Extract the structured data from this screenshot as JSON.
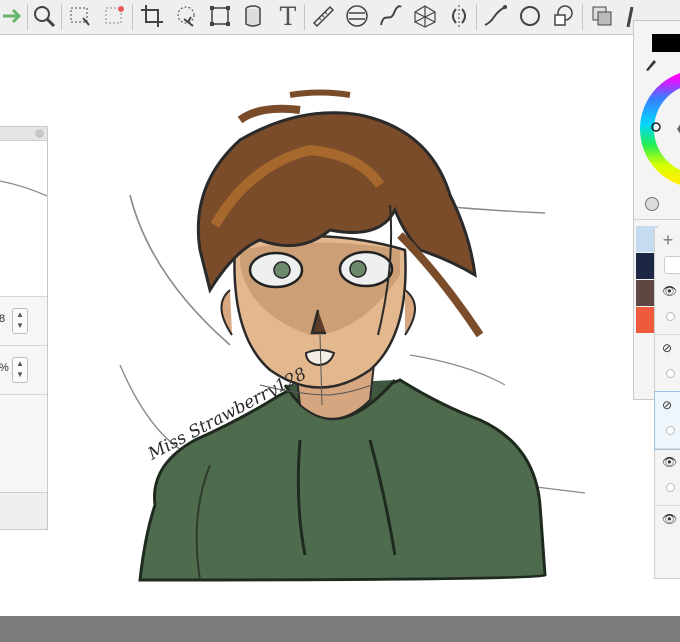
{
  "toolbar": {
    "tools": [
      {
        "name": "arrow-right-icon"
      },
      {
        "name": "zoom-icon"
      },
      {
        "name": "rect-select-icon"
      },
      {
        "name": "magic-select-icon"
      },
      {
        "name": "crop-icon"
      },
      {
        "name": "lasso-select-icon"
      },
      {
        "name": "transform-icon"
      },
      {
        "name": "cylinder-icon"
      },
      {
        "name": "text-tool-icon",
        "glyph": "T"
      },
      {
        "name": "ruler-icon"
      },
      {
        "name": "ellipse-guide-icon"
      },
      {
        "name": "curve-icon"
      },
      {
        "name": "perspective-grid-icon"
      },
      {
        "name": "symmetry-icon"
      },
      {
        "name": "french-curve-icon"
      },
      {
        "name": "circle-icon"
      },
      {
        "name": "shapes-icon"
      },
      {
        "name": "layer-copy-icon"
      },
      {
        "name": "pencil-icon"
      }
    ]
  },
  "left_panel": {
    "value_1": "8",
    "value_2": "%"
  },
  "color_panel": {
    "current_color": "#000000",
    "swatches": [
      "#c6dbef",
      "#1c2645",
      "#5e4642",
      "#ef5a3c"
    ]
  },
  "artwork": {
    "signature": "Miss Strawberry128"
  },
  "layers": [
    {
      "visible_icon": "eye-icon"
    },
    {
      "visible_icon": "eye-slash-icon"
    },
    {
      "visible_icon": "eye-slash-icon",
      "selected": true
    },
    {
      "visible_icon": "eye-icon"
    },
    {
      "visible_icon": "eye-icon"
    }
  ]
}
